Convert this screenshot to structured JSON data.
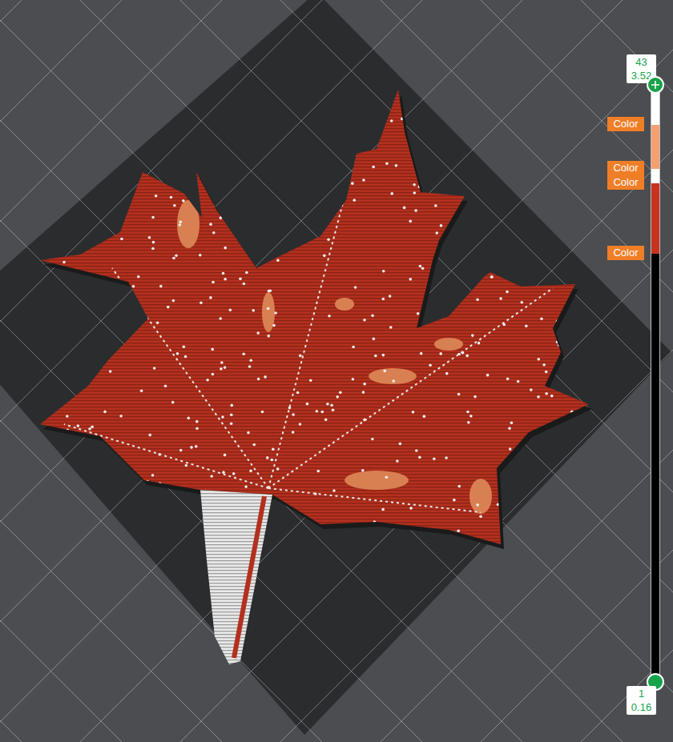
{
  "viewport": {
    "object": "maple leaf layer preview"
  },
  "layer_slider": {
    "top": {
      "layer": "43",
      "height": "3.52"
    },
    "bottom": {
      "layer": "1",
      "height": "0.16"
    },
    "segments": [
      {
        "color": "#ffffff",
        "level": 0.066,
        "marker": null
      },
      {
        "color": "#f4a070",
        "level": 0.074,
        "marker": "Color"
      },
      {
        "color": "#ffffff",
        "level": 0.024,
        "marker": "Color"
      },
      {
        "color": "#c9321f",
        "level": 0.118,
        "marker": "Color"
      },
      {
        "color": "#000000",
        "level": 0.718,
        "marker": "Color"
      }
    ]
  }
}
